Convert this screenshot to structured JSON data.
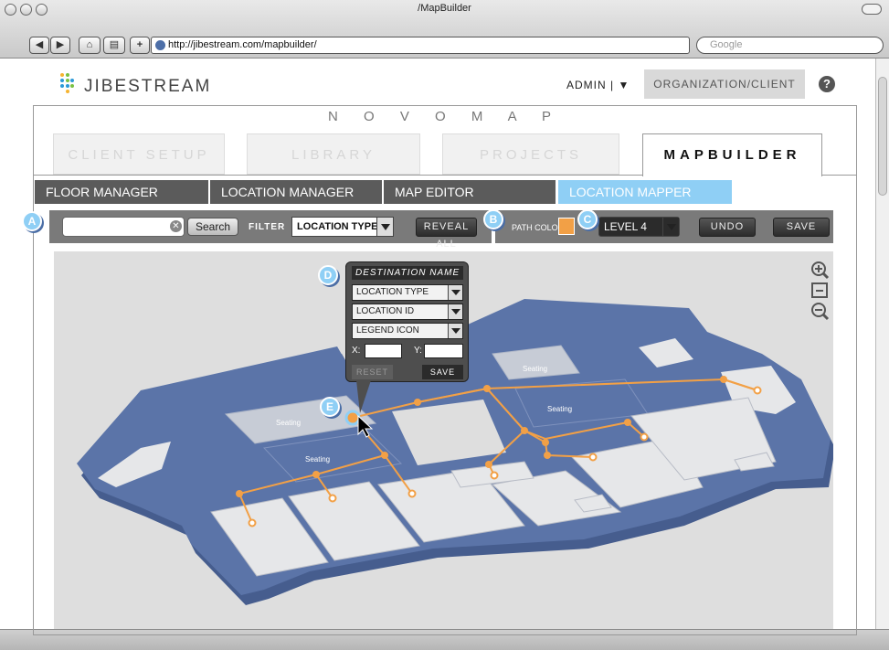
{
  "browser": {
    "window_title": "/MapBuilder",
    "url": "http://jibestream.com/mapbuilder/",
    "search_placeholder": "Google"
  },
  "header": {
    "brand": "JIBESTREAM",
    "admin_label": "ADMIN |",
    "org_button": "ORGANIZATION/CLIENT",
    "help": "?"
  },
  "product": "N O V O M A P",
  "tabs": [
    {
      "label": "CLIENT SETUP",
      "active": false
    },
    {
      "label": "LIBRARY",
      "active": false
    },
    {
      "label": "PROJECTS",
      "active": false
    },
    {
      "label": "MAPBUILDER",
      "active": true
    }
  ],
  "subnav": [
    {
      "label": "FLOOR MANAGER",
      "active": false
    },
    {
      "label": "LOCATION MANAGER",
      "active": false
    },
    {
      "label": "MAP EDITOR",
      "active": false
    },
    {
      "label": "LOCATION MAPPER",
      "active": true
    }
  ],
  "toolbar": {
    "search_value": "",
    "search_button": "Search",
    "filter_label": "FILTER",
    "filter_value": "LOCATION TYPE",
    "reveal_all": "REVEAL ALL",
    "path_colour_label": "PATH COLOUR",
    "path_colour": "#f2a046",
    "level_value": "LEVEL 4",
    "undo": "UNDO",
    "save": "SAVE"
  },
  "markers": {
    "a": "A",
    "b": "B",
    "c": "C",
    "d": "D",
    "e": "E"
  },
  "popup": {
    "title": "DESTINATION NAME",
    "location_type": "LOCATION TYPE",
    "location_id": "LOCATION ID",
    "legend_icon": "LEGEND ICON",
    "x_label": "X:",
    "y_label": "Y:",
    "x_value": "",
    "y_value": "",
    "reset": "RESET",
    "save": "SAVE"
  },
  "map": {
    "seating_labels": [
      "Seating",
      "Seating",
      "Seating",
      "Seating"
    ],
    "floor_color": "#5b74a8",
    "room_color": "#e6e7e9",
    "path_color": "#f2a046"
  },
  "zoom": [
    "zoom-in-icon",
    "fit-icon",
    "zoom-out-icon"
  ]
}
